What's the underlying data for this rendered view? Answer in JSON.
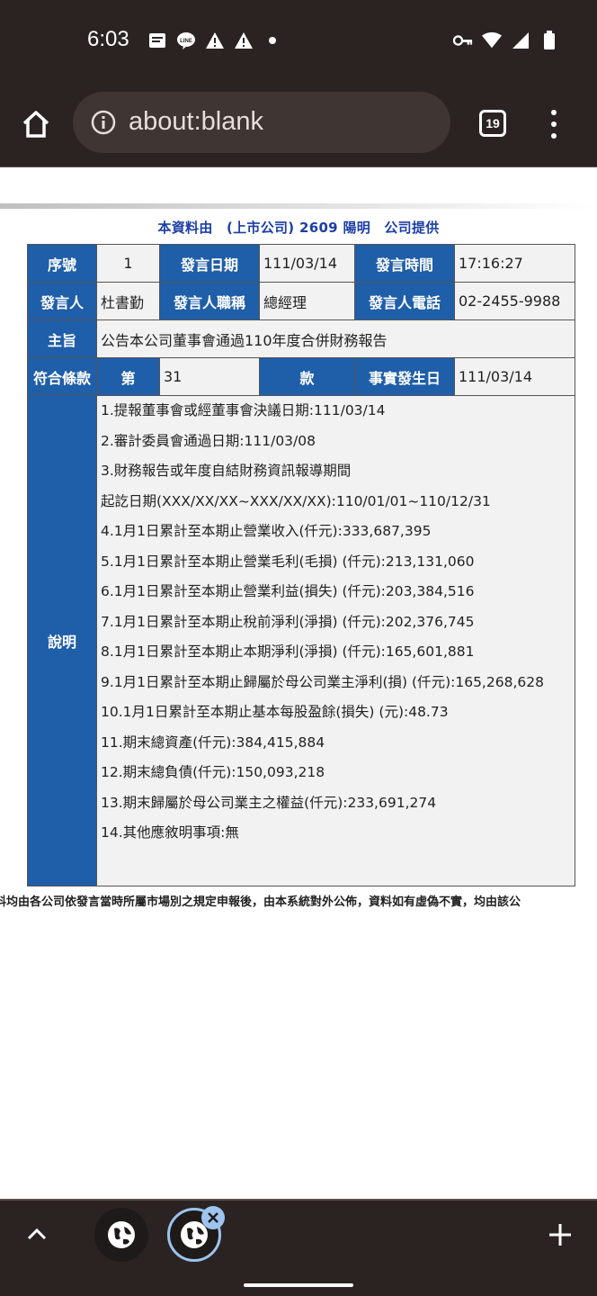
{
  "status_bar": {
    "time": "6:03",
    "left_icons": [
      "message-icon",
      "line-icon",
      "warning-icon",
      "warning-icon",
      "dot-icon"
    ],
    "right_icons": [
      "vpn-key-icon",
      "wifi-icon",
      "signal-icon",
      "battery-icon"
    ]
  },
  "browser": {
    "url": "about:blank",
    "tab_count": "19"
  },
  "page": {
    "source_line": "本資料由　(上市公司) 2609 陽明　公司提供",
    "labels": {
      "seq": "序號",
      "date": "發言日期",
      "time": "發言時間",
      "speaker": "發言人",
      "speaker_title": "發言人職稱",
      "speaker_phone": "發言人電話",
      "subject": "主旨",
      "clause": "符合條款",
      "clause_prefix": "第",
      "clause_suffix": "款",
      "event_date": "事實發生日",
      "description": "說明"
    },
    "values": {
      "seq": "1",
      "date": "111/03/14",
      "time": "17:16:27",
      "speaker": "杜書勤",
      "speaker_title": "總經理",
      "speaker_phone": "02-2455-9988",
      "subject": "公告本公司董事會通過110年度合併財務報告",
      "clause_no": "31",
      "event_date": "111/03/14"
    },
    "description_lines": [
      "1.提報董事會或經董事會決議日期:111/03/14",
      "2.審計委員會通過日期:111/03/08",
      "3.財務報告或年度自結財務資訊報導期間",
      "起訖日期(XXX/XX/XX~XXX/XX/XX):110/01/01~110/12/31",
      "4.1月1日累計至本期止營業收入(仟元):333,687,395",
      "5.1月1日累計至本期止營業毛利(毛損) (仟元):213,131,060",
      "6.1月1日累計至本期止營業利益(損失) (仟元):203,384,516",
      "7.1月1日累計至本期止稅前淨利(淨損) (仟元):202,376,745",
      "8.1月1日累計至本期止本期淨利(淨損) (仟元):165,601,881",
      "9.1月1日累計至本期止歸屬於母公司業主淨利(損) (仟元):165,268,628",
      "10.1月1日累計至本期止基本每股盈餘(損失) (元):48.73",
      "11.期末總資產(仟元):384,415,884",
      "12.期末總負債(仟元):150,093,218",
      "13.期末歸屬於母公司業主之權益(仟元):233,691,274",
      "14.其他應敘明事項:無"
    ],
    "footer_note": "料均由各公司依發言當時所屬市場別之規定申報後，由本系統對外公佈，資料如有虛偽不實，均由該公"
  },
  "bottom_bar": {
    "icons": [
      "chevron-up-icon",
      "globe-icon",
      "globe-icon",
      "close-icon",
      "plus-icon"
    ]
  },
  "colors": {
    "header_cell": "#1f5ea8",
    "value_cell": "#f2f2f2",
    "source_text": "#1d3ea8",
    "chrome": "#2b2322"
  }
}
